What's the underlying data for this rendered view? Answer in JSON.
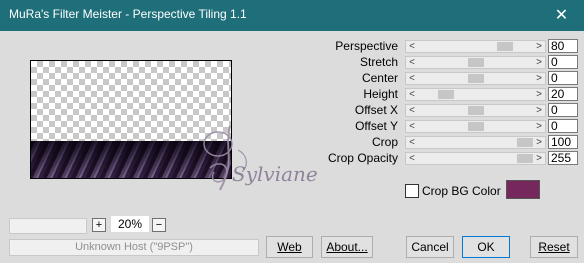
{
  "window": {
    "title": "MuRa's Filter Meister - Perspective Tiling 1.1",
    "close_glyph": "✕"
  },
  "preview": {
    "zoom_value": "20%",
    "zoom_plus": "+",
    "zoom_minus": "−"
  },
  "status_text": "Unknown Host (\"9PSP\")",
  "watermark_text": "Sylviane",
  "parameters": [
    {
      "label": "Perspective",
      "value": "80",
      "level": 0.8
    },
    {
      "label": "Stretch",
      "value": "0",
      "level": 0.5
    },
    {
      "label": "Center",
      "value": "0",
      "level": 0.5
    },
    {
      "label": "Height",
      "value": "20",
      "level": 0.2
    },
    {
      "label": "Offset X",
      "value": "0",
      "level": 0.5
    },
    {
      "label": "Offset Y",
      "value": "0",
      "level": 0.5
    },
    {
      "label": "Crop",
      "value": "100",
      "level": 1.0
    },
    {
      "label": "Crop Opacity",
      "value": "255",
      "level": 1.0
    }
  ],
  "slider_arrows": {
    "left": "<",
    "right": ">"
  },
  "crop_bg": {
    "label": "Crop BG Color",
    "checked": false,
    "color": "#76285d"
  },
  "buttons": {
    "web": "Web",
    "about": "About...",
    "cancel": "Cancel",
    "ok": "OK",
    "reset": "Reset"
  }
}
